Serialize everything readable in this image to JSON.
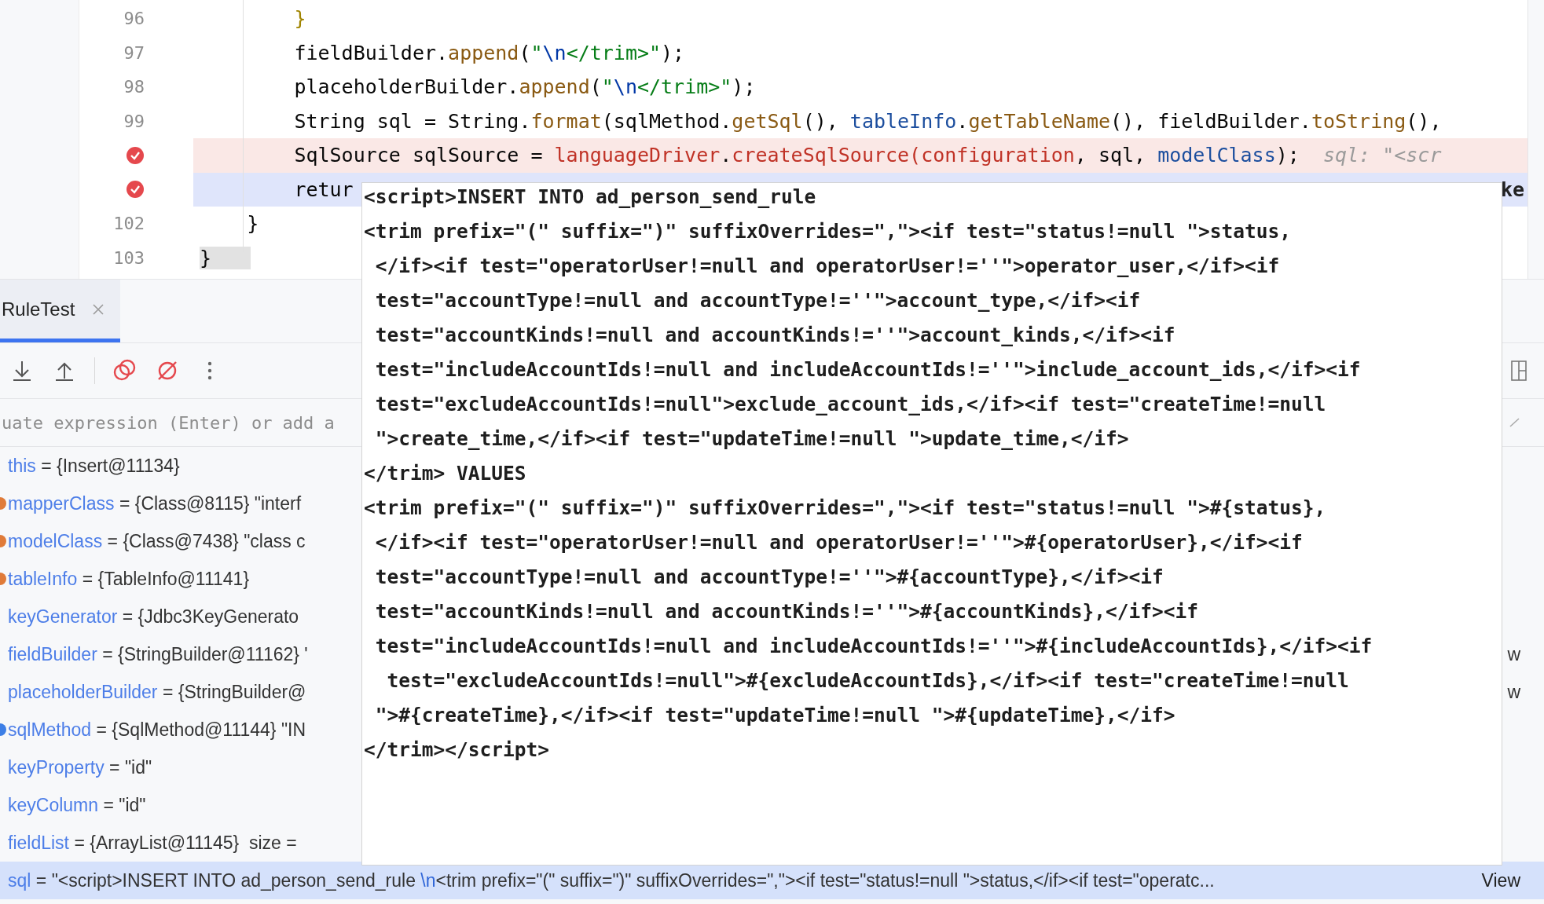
{
  "editor": {
    "lines": [
      {
        "kind": "number",
        "number": "96",
        "current": false,
        "tokens": [
          {
            "kind": "brace",
            "text": "        }"
          }
        ]
      },
      {
        "kind": "number",
        "number": "97",
        "current": false,
        "tokens": [
          {
            "kind": "plain",
            "text": "        fieldBuilder."
          },
          {
            "kind": "method",
            "text": "append"
          },
          {
            "kind": "plain",
            "text": "("
          },
          {
            "kind": "string",
            "text": "\""
          },
          {
            "kind": "escape",
            "text": "\\n"
          },
          {
            "kind": "string",
            "text": "</trim>\""
          },
          {
            "kind": "plain",
            "text": ");"
          }
        ]
      },
      {
        "kind": "number",
        "number": "98",
        "current": false,
        "tokens": [
          {
            "kind": "plain",
            "text": "        placeholderBuilder."
          },
          {
            "kind": "method",
            "text": "append"
          },
          {
            "kind": "plain",
            "text": "("
          },
          {
            "kind": "string",
            "text": "\""
          },
          {
            "kind": "escape",
            "text": "\\n"
          },
          {
            "kind": "string",
            "text": "</trim>\""
          },
          {
            "kind": "plain",
            "text": ");"
          }
        ]
      },
      {
        "kind": "number",
        "number": "99",
        "current": false,
        "tokens": [
          {
            "kind": "plain",
            "text": "        String sql = String."
          },
          {
            "kind": "method",
            "text": "format"
          },
          {
            "kind": "plain",
            "text": "(sqlMethod."
          },
          {
            "kind": "method",
            "text": "getSql"
          },
          {
            "kind": "plain",
            "text": "(), "
          },
          {
            "kind": "field",
            "text": "tableInfo"
          },
          {
            "kind": "plain",
            "text": "."
          },
          {
            "kind": "method",
            "text": "getTableName"
          },
          {
            "kind": "plain",
            "text": "(), fieldBuilder."
          },
          {
            "kind": "method",
            "text": "toString"
          },
          {
            "kind": "plain",
            "text": "(),"
          }
        ]
      },
      {
        "kind": "breakpoint",
        "current": false,
        "tokens": [
          {
            "kind": "plain",
            "text": "        SqlSource sqlSource = "
          },
          {
            "kind": "error",
            "text": "languageDriver"
          },
          {
            "kind": "plain",
            "text": "."
          },
          {
            "kind": "error",
            "text": "createSqlSource(configuration"
          },
          {
            "kind": "plain",
            "text": ", sql, "
          },
          {
            "kind": "field",
            "text": "modelClass"
          },
          {
            "kind": "plain",
            "text": ");  "
          },
          {
            "kind": "hint",
            "text": "sql: \"<scr"
          }
        ]
      },
      {
        "kind": "breakpoint",
        "current": true,
        "tokens": [
          {
            "kind": "plain",
            "text": "        retur"
          }
        ],
        "tail": "ke"
      },
      {
        "kind": "number",
        "number": "102",
        "current": false,
        "tokens": [
          {
            "kind": "plain",
            "text": "    }"
          }
        ]
      },
      {
        "kind": "number",
        "number": "103",
        "current": false,
        "tokens": [
          {
            "kind": "matched",
            "text": "}"
          }
        ]
      }
    ]
  },
  "debugger": {
    "tabs": [
      {
        "label": "RuleTest",
        "selected": true
      }
    ],
    "eval_placeholder": "uate expression (Enter) or add a",
    "variables": [
      {
        "name": "this",
        "sep": "=",
        "value": "{Insert@11134}",
        "selected": false
      },
      {
        "name": "mapperClass",
        "sep": "=",
        "value": "{Class@8115} \"interf",
        "color": "#e07b39",
        "selected": false
      },
      {
        "name": "modelClass",
        "sep": "=",
        "value": "{Class@7438} \"class c",
        "color": "#e07b39",
        "selected": false
      },
      {
        "name": "tableInfo",
        "sep": "=",
        "value": "{TableInfo@11141}",
        "color": "#e07b39",
        "selected": false
      },
      {
        "name": "keyGenerator",
        "sep": "=",
        "value": "{Jdbc3KeyGenerato",
        "selected": false
      },
      {
        "name": "fieldBuilder",
        "sep": "=",
        "value": "{StringBuilder@11162} '",
        "selected": false,
        "tail": "w"
      },
      {
        "name": "placeholderBuilder",
        "sep": "=",
        "value": "{StringBuilder@",
        "selected": false,
        "tail": "w"
      },
      {
        "name": "sqlMethod",
        "sep": "=",
        "value": "{SqlMethod@11144} \"IN",
        "color": "#3d7fe6",
        "selected": false
      },
      {
        "name": "keyProperty",
        "sep": "=",
        "value": "\"id\"",
        "selected": false
      },
      {
        "name": "keyColumn",
        "sep": "=",
        "value": "\"id\"",
        "selected": false
      },
      {
        "name": "fieldList",
        "sep": "=",
        "value": "{ArrayList@11145}  size =",
        "selected": false
      },
      {
        "name": "sql",
        "sep": "=",
        "parts": [
          {
            "kind": "plain",
            "text": "\"<script>INSERT INTO ad_person_send_rule "
          },
          {
            "kind": "escape",
            "text": "\\n"
          },
          {
            "kind": "plain",
            "text": "<trim prefix=\"(\" suffix=\")\" suffixOverrides=\",\"><if test=\"status!=null \">status,</if><if test=\"operatc..."
          }
        ],
        "link": "View",
        "selected": true
      }
    ]
  },
  "popup": {
    "lines": [
      "<script>INSERT INTO ad_person_send_rule",
      "<trim prefix=\"(\" suffix=\")\" suffixOverrides=\",\"><if test=\"status!=null \">status,",
      " </if><if test=\"operatorUser!=null and operatorUser!=''\">operator_user,</if><if",
      " test=\"accountType!=null and accountType!=''\">account_type,</if><if",
      " test=\"accountKinds!=null and accountKinds!=''\">account_kinds,</if><if",
      " test=\"includeAccountIds!=null and includeAccountIds!=''\">include_account_ids,</if><if",
      " test=\"excludeAccountIds!=null\">exclude_account_ids,</if><if test=\"createTime!=null",
      " \">create_time,</if><if test=\"updateTime!=null \">update_time,</if>",
      "</trim> VALUES",
      "<trim prefix=\"(\" suffix=\")\" suffixOverrides=\",\"><if test=\"status!=null \">#{status},",
      " </if><if test=\"operatorUser!=null and operatorUser!=''\">#{operatorUser},</if><if",
      " test=\"accountType!=null and accountType!=''\">#{accountType},</if><if",
      " test=\"accountKinds!=null and accountKinds!=''\">#{accountKinds},</if><if",
      " test=\"includeAccountIds!=null and includeAccountIds!=''\">#{includeAccountIds},</if><if",
      "  test=\"excludeAccountIds!=null\">#{excludeAccountIds},</if><if test=\"createTime!=null",
      " \">#{createTime},</if><if test=\"updateTime!=null \">#{updateTime},</if>",
      "</trim></script>"
    ]
  }
}
